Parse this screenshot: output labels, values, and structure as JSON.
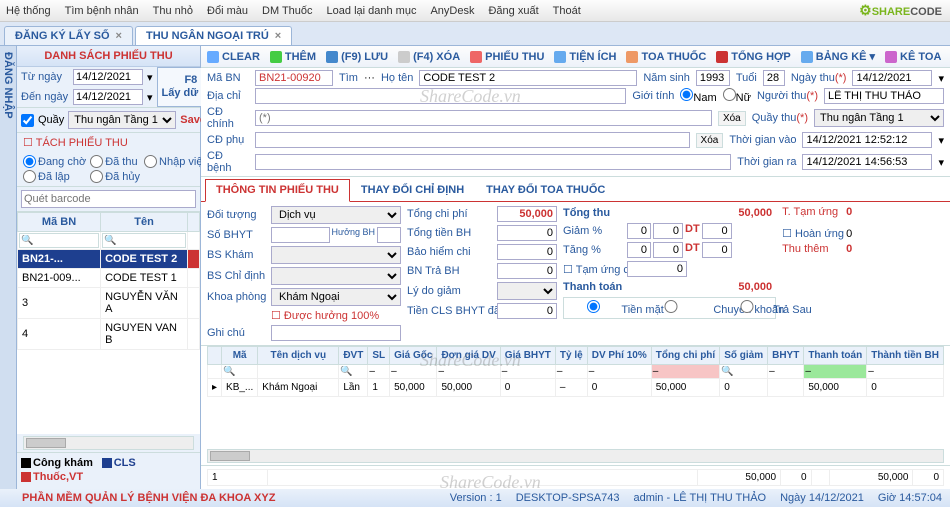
{
  "menu": [
    "Hệ thống",
    "Tìm bệnh nhân",
    "Thu nhỏ",
    "Đổi màu",
    "DM Thuốc",
    "Load lại danh mục",
    "AnyDesk",
    "Đăng xuất",
    "Thoát"
  ],
  "logo": {
    "a": "SHARE",
    "b": "CODE"
  },
  "tabs": [
    {
      "label": "ĐĂNG KÝ LẤY SỐ",
      "active": false
    },
    {
      "label": "THU NGÂN NGOẠI TRÚ",
      "active": true
    }
  ],
  "sidebar_tab": "ĐĂNG NHẬP",
  "left": {
    "title": "DANH SÁCH PHIẾU THU",
    "from_lbl": "Từ ngày",
    "from": "14/12/2021",
    "to_lbl": "Đến ngày",
    "to": "14/12/2021",
    "f8": "F8\nLấy dữ liệu",
    "quay_lbl": "Quầy",
    "quay": "Thu ngân Tầng 1",
    "save": "Save",
    "tach": "TÁCH PHIẾU THU",
    "radios": [
      "Đang chờ",
      "Đã thu",
      "Nhập viện",
      "Đã lập",
      "Đã hủy"
    ],
    "barcode_lbl": "Quét barcode",
    "cols": [
      "Mã BN",
      "Tên"
    ],
    "rows": [
      {
        "ma": "BN21-...",
        "ten": "CODE TEST 2",
        "sel": true
      },
      {
        "ma": "BN21-009...",
        "ten": "CODE TEST 1"
      },
      {
        "ma": "3",
        "ten": "NGUYỄN VĂN A"
      },
      {
        "ma": "4",
        "ten": "NGUYEN VAN B"
      }
    ],
    "legend": [
      {
        "c": "#000",
        "t": "Công khám"
      },
      {
        "c": "#1e3f8f",
        "t": "CLS"
      },
      {
        "c": "#c33",
        "t": "Thuốc,VT"
      }
    ]
  },
  "toolbar": [
    {
      "t": "CLEAR",
      "c": "#2a5a9e"
    },
    {
      "t": "THÊM",
      "c": "#2a5a9e"
    },
    {
      "t": "(F9) LƯU",
      "c": "#2a5a9e"
    },
    {
      "t": "(F4) XÓA",
      "c": "#aaa"
    },
    {
      "t": "PHIẾU THU",
      "c": "#2a5a9e"
    },
    {
      "t": "TIỆN ÍCH",
      "c": "#2a5a9e"
    },
    {
      "t": "TOA THUỐC",
      "c": "#2a5a9e"
    },
    {
      "t": "TỔNG HỢP",
      "c": "#c33"
    },
    {
      "t": "BẢNG KÊ",
      "c": "#2a5a9e"
    },
    {
      "t": "KÊ TOA",
      "c": "#2a5a9e"
    }
  ],
  "form": {
    "mabn_lbl": "Mã BN",
    "mabn": "BN21-00920",
    "tim": "Tìm",
    "more": "···",
    "hoten_lbl": "Họ tên",
    "hoten": "CODE TEST 2",
    "namsinh_lbl": "Năm sinh",
    "namsinh": "1993",
    "tuoi_lbl": "Tuổi",
    "tuoi": "28",
    "ngaythu_lbl": "Ngày thu",
    "ngaythu": "14/12/2021",
    "req": "(*)",
    "diachi_lbl": "Địa chỉ",
    "gioitinh_lbl": "Giới tính",
    "nam": "Nam",
    "nu": "Nữ",
    "nguoithu_lbl": "Người thu",
    "nguoithu": "LÊ THỊ THU THẢO",
    "cdchinh_lbl": "CĐ chính",
    "quaythu_lbl": "Quầy thu",
    "quaythu": "Thu ngân Tầng 1",
    "cdphu_lbl": "CĐ phụ",
    "tgvao_lbl": "Thời gian vào",
    "tgvao": "14/12/2021 12:52:12",
    "cdbenh_lbl": "CĐ bệnh",
    "tgra_lbl": "Thời gian ra",
    "tgra": "14/12/2021 14:56:53",
    "xoa": "Xóa"
  },
  "subtabs": [
    "THÔNG TIN PHIẾU THU",
    "THAY ĐỔI CHỈ ĐỊNH",
    "THAY ĐỔI TOA THUỐC"
  ],
  "det": {
    "doituong_lbl": "Đối tượng",
    "doituong": "Dịch vụ",
    "sobhyt_lbl": "Số BHYT",
    "huongbh_lbl": "Hưởng BH",
    "bskham_lbl": "BS Khám",
    "bscd_lbl": "BS Chỉ định",
    "khoa_lbl": "Khoa phòng",
    "khoa": "Khám Ngoại",
    "huong100": "Được hưởng 100%",
    "ghichu_lbl": "Ghi chú",
    "tongcp_lbl": "Tổng chi phí",
    "tongcp": "50,000",
    "tongbh_lbl": "Tổng tiền BH",
    "tongbh": "0",
    "bhchi_lbl": "Bảo hiểm chi",
    "bhchi": "0",
    "bntra_lbl": "BN Trả BH",
    "bntra": "0",
    "lydo_lbl": "Lý do giảm",
    "cls_lbl": "Tiền CLS BHYT đã thu",
    "cls": "0",
    "tongthu_lbl": "Tổng thu",
    "tongthu": "50,000",
    "giam_lbl": "Giảm %",
    "giam_p": "0",
    "giam_v": "0",
    "dt_lbl": "DT",
    "dt": "0",
    "tang_lbl": "Tăng %",
    "tang_p": "0",
    "tang_v": "0",
    "dt2": "0",
    "tamung_lbl": "Tạm ứng còn",
    "tamung": "0",
    "thanhtoan_lbl": "Thanh toán",
    "thanhtoan": "50,000",
    "pay": [
      "Tiền mặt",
      "Chuyển khoản",
      "Trả Sau"
    ],
    "ttamung_lbl": "T. Tạm ứng",
    "ttamung": "0",
    "hoanung_lbl": "Hoàn ứng",
    "hoanung": "0",
    "thuthem_lbl": "Thu thêm",
    "thuthem": "0"
  },
  "gcols": [
    "",
    "Mã",
    "Tên dịch vụ",
    "ĐVT",
    "SL",
    "Giá Gốc",
    "Đơn giá DV",
    "Giá BHYT",
    "Tỷ lệ",
    "DV Phí 10%",
    "Tổng chi phí",
    "Số giảm",
    "BHYT",
    "Thanh toán",
    "Thành tiền BH"
  ],
  "grow": {
    "ma": "KB_...",
    "ten": "Khám Ngoại",
    "dvt": "Lần",
    "sl": "1",
    "gg": "50,000",
    "dg": "50,000",
    "bhyt": "0",
    "tyle": "–",
    "dv10": "0",
    "tcp": "50,000",
    "sg": "0",
    "bh": "",
    "tt": "50,000",
    "ttbh": "0"
  },
  "sum": {
    "c1": "1",
    "tcp": "50,000",
    "sg": "0",
    "tt": "50,000",
    "ttbh": "0"
  },
  "status": {
    "app": "PHẦN MỀM QUẢN LÝ BỆNH VIỆN ĐA KHOA XYZ",
    "ver": "Version : 1",
    "host": "DESKTOP-SPSA743",
    "user": "admin - LÊ THỊ THU THẢO",
    "date": "Ngày 14/12/2021",
    "time": "Giờ 14:57:04"
  },
  "wm": "ShareCode.vn"
}
